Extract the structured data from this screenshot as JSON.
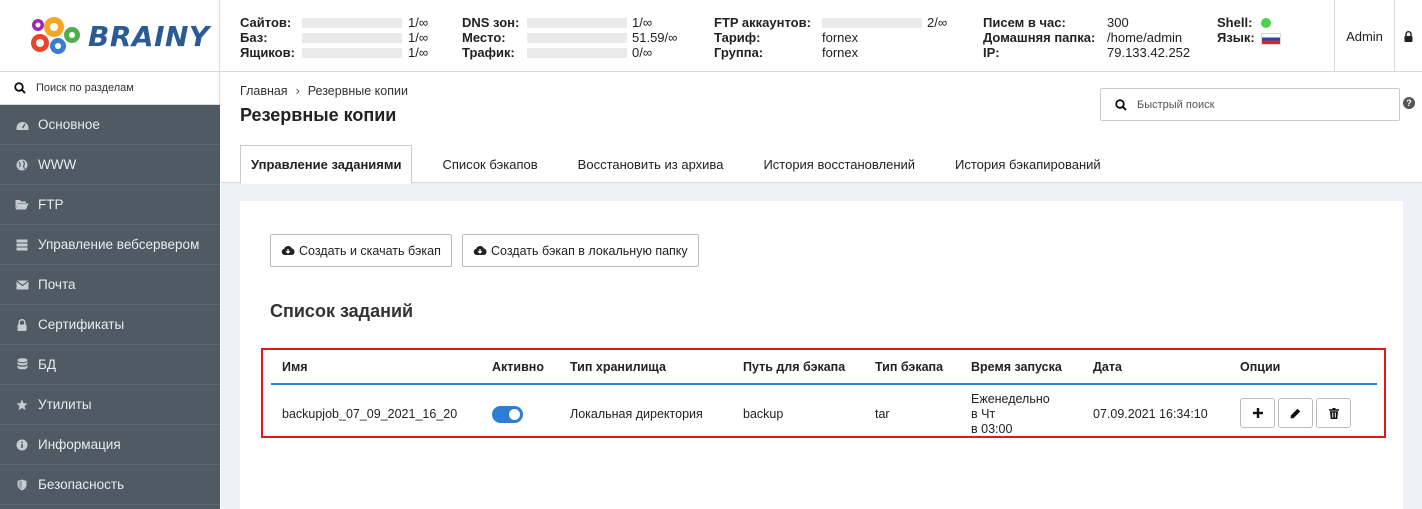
{
  "logo": {
    "text": "BRAINY"
  },
  "stats": {
    "group1": [
      {
        "label": "Сайтов:",
        "value": "1/∞"
      },
      {
        "label": "Баз:",
        "value": "1/∞"
      },
      {
        "label": "Ящиков:",
        "value": "1/∞"
      }
    ],
    "group2": [
      {
        "label": "DNS зон:",
        "value": "1/∞"
      },
      {
        "label": "Место:",
        "value": "51.59/∞"
      },
      {
        "label": "Трафик:",
        "value": "0/∞"
      }
    ],
    "group3": [
      {
        "label": "FTP аккаунтов:",
        "value": "2/∞"
      },
      {
        "label": "Тариф:",
        "value": "fornex"
      },
      {
        "label": "Группа:",
        "value": "fornex"
      }
    ],
    "group4": [
      {
        "label": "Писем в час:",
        "value": "300"
      },
      {
        "label": "Домашняя папка:",
        "value": "/home/admin"
      },
      {
        "label": "IP:",
        "value": "79.133.42.252"
      }
    ],
    "group5": [
      {
        "label": "Shell:"
      },
      {
        "label": "Язык:"
      }
    ]
  },
  "user": {
    "name": "Admin"
  },
  "sidebar": {
    "search_placeholder": "Поиск по разделам",
    "items": [
      {
        "label": "Основное",
        "icon": "dashboard-icon"
      },
      {
        "label": "WWW",
        "icon": "globe-icon"
      },
      {
        "label": "FTP",
        "icon": "folder-open-icon"
      },
      {
        "label": "Управление вебсервером",
        "icon": "server-icon"
      },
      {
        "label": "Почта",
        "icon": "envelope-icon"
      },
      {
        "label": "Сертификаты",
        "icon": "lock-icon"
      },
      {
        "label": "БД",
        "icon": "database-icon"
      },
      {
        "label": "Утилиты",
        "icon": "star-icon"
      },
      {
        "label": "Информация",
        "icon": "info-icon"
      },
      {
        "label": "Безопасность",
        "icon": "shield-icon"
      }
    ]
  },
  "breadcrumb": {
    "home": "Главная",
    "current": "Резервные копии"
  },
  "page": {
    "title": "Резервные копии"
  },
  "quick_search": {
    "placeholder": "Быстрый поиск"
  },
  "tabs": [
    {
      "label": "Управление заданиями",
      "active": true
    },
    {
      "label": "Список бэкапов"
    },
    {
      "label": "Восстановить из архива"
    },
    {
      "label": "История восстановлений"
    },
    {
      "label": "История бэкапирований"
    }
  ],
  "actions": {
    "create_download": "Создать и скачать бэкап",
    "create_local": "Создать бэкап в локальную папку"
  },
  "jobs": {
    "title": "Список заданий",
    "columns": [
      "Имя",
      "Активно",
      "Тип хранилища",
      "Путь для бэкапа",
      "Тип бэкапа",
      "Время запуска",
      "Дата",
      "Опции"
    ],
    "rows": [
      {
        "name": "backupjob_07_09_2021_16_20",
        "active": true,
        "storage": "Локальная директория",
        "path": "backup",
        "type": "tar",
        "schedule": [
          "Еженедельно",
          "в Чт",
          "в 03:00"
        ],
        "date": "07.09.2021 16:34:10"
      }
    ]
  },
  "colors": {
    "accent": "#2d7fd6",
    "sidebar_bg": "#4f5a63",
    "highlight": "#e0181b",
    "logo": "#2b5a95"
  }
}
